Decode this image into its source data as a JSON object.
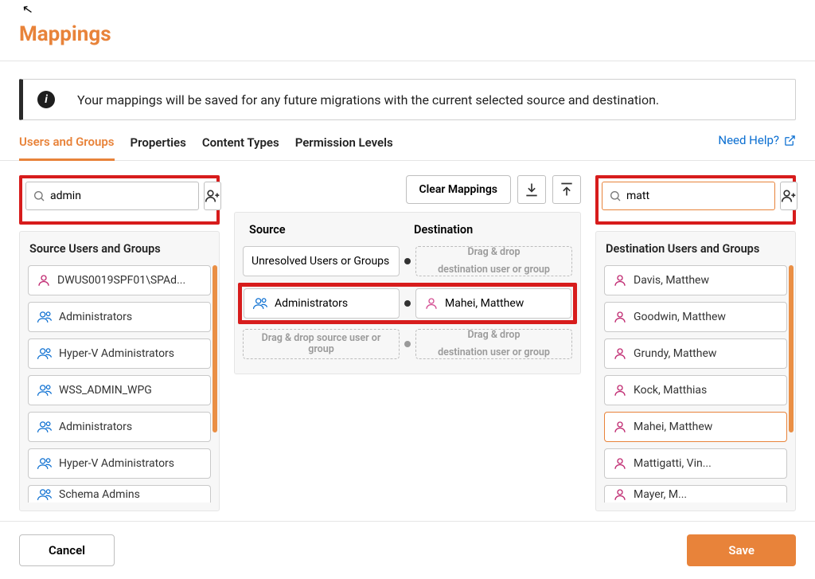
{
  "header": {
    "title": "Mappings"
  },
  "info": {
    "message": "Your mappings will be saved for any future migrations with the current selected source and destination."
  },
  "tabs": {
    "items": [
      "Users and Groups",
      "Properties",
      "Content Types",
      "Permission Levels"
    ],
    "active_index": 0,
    "help_label": "Need Help?"
  },
  "toolbar": {
    "clear_label": "Clear Mappings"
  },
  "source": {
    "search_value": "admin",
    "panel_title": "Source Users and Groups",
    "items": [
      {
        "label": "DWUS0019SPF01\\SPAd...",
        "icon": "user-single"
      },
      {
        "label": "Administrators",
        "icon": "user-group"
      },
      {
        "label": "Hyper-V Administrators",
        "icon": "user-group"
      },
      {
        "label": "WSS_ADMIN_WPG",
        "icon": "user-group"
      },
      {
        "label": "Administrators",
        "icon": "user-group"
      },
      {
        "label": "Hyper-V Administrators",
        "icon": "user-group"
      },
      {
        "label": "Schema Admins",
        "icon": "user-group"
      }
    ]
  },
  "mapping": {
    "head_source": "Source",
    "head_dest": "Destination",
    "placeholder_src": "Drag & drop source user or group",
    "placeholder_dest_l1": "Drag & drop",
    "placeholder_dest_l2": "destination user or group",
    "rows": [
      {
        "src": {
          "label": "Unresolved Users or Groups",
          "icon": null
        },
        "dest": null
      },
      {
        "src": {
          "label": "Administrators",
          "icon": "user-group"
        },
        "dest": {
          "label": "Mahei, Matthew",
          "icon": "user-pink"
        }
      }
    ]
  },
  "destination": {
    "search_value": "matt",
    "panel_title": "Destination Users and Groups",
    "items": [
      {
        "label": "Davis, Matthew",
        "icon": "user-single"
      },
      {
        "label": "Goodwin, Matthew",
        "icon": "user-single"
      },
      {
        "label": "Grundy, Matthew",
        "icon": "user-single"
      },
      {
        "label": "Kock, Matthias",
        "icon": "user-single"
      },
      {
        "label": "Mahei, Matthew",
        "icon": "user-single",
        "selected": true
      },
      {
        "label": "Mattigatti, Vin...",
        "icon": "user-single"
      },
      {
        "label": "Mayer, M...",
        "icon": "user-single"
      }
    ]
  },
  "footer": {
    "cancel_label": "Cancel",
    "save_label": "Save"
  },
  "colors": {
    "accent": "#e8833a",
    "link": "#0a6ed1",
    "user_single": "#c02a71",
    "user_group": "#0a6ed1",
    "highlight_border": "#d71c1c"
  }
}
